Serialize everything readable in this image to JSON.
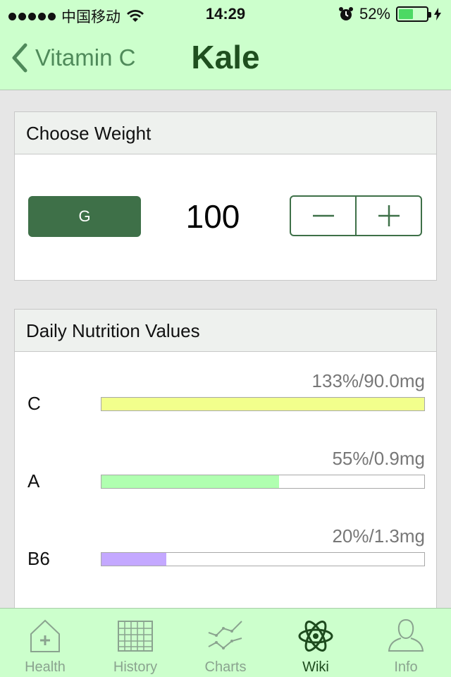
{
  "status_bar": {
    "carrier": "中国移动",
    "time": "14:29",
    "battery_percent": "52%",
    "battery_level": 0.52,
    "icons": [
      "signal-dots",
      "wifi-icon",
      "alarm-icon",
      "battery-icon",
      "charging-icon"
    ]
  },
  "nav": {
    "back_label": "Vitamin C",
    "title": "Kale",
    "back_icon": "chevron-left-icon"
  },
  "weight_card": {
    "header": "Choose Weight",
    "unit_label": "G",
    "value": "100",
    "minus_icon": "minus-icon",
    "plus_icon": "plus-icon"
  },
  "nutrition_card": {
    "header": "Daily Nutrition Values",
    "nutrients": [
      {
        "name": "C",
        "amount": "133%/90.0mg",
        "percent": 133,
        "color": "#f2ff8c"
      },
      {
        "name": "A",
        "amount": "55%/0.9mg",
        "percent": 55,
        "color": "#b0ffb0"
      },
      {
        "name": "B6",
        "amount": "20%/1.3mg",
        "percent": 20,
        "color": "#c4a8ff"
      }
    ]
  },
  "tabs": [
    {
      "label": "Health",
      "icon": "health-house-icon",
      "active": false
    },
    {
      "label": "History",
      "icon": "history-grid-icon",
      "active": false
    },
    {
      "label": "Charts",
      "icon": "charts-line-icon",
      "active": false
    },
    {
      "label": "Wiki",
      "icon": "wiki-atom-icon",
      "active": true
    },
    {
      "label": "Info",
      "icon": "info-person-icon",
      "active": false
    }
  ],
  "colors": {
    "bar_background": "#ccffcc",
    "accent_dark_green": "#3e7048",
    "title_green": "#1f4f1f",
    "inactive_tab": "#8aa38f",
    "active_tab": "#1d4a1d"
  }
}
